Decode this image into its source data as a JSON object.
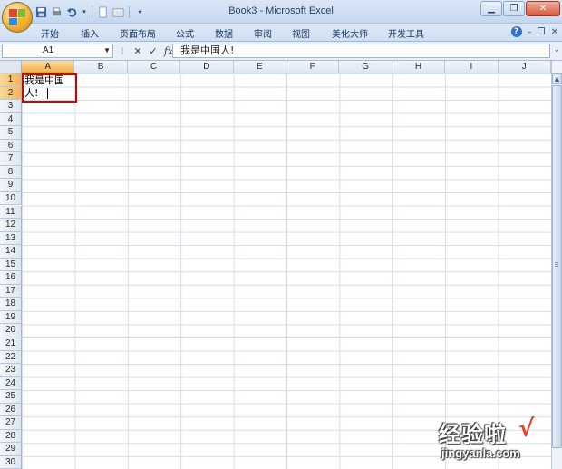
{
  "window": {
    "title": "Book3 - Microsoft Excel"
  },
  "tabs": [
    "开始",
    "插入",
    "页面布局",
    "公式",
    "数据",
    "审阅",
    "视图",
    "美化大师",
    "开发工具"
  ],
  "formula_bar": {
    "name_box": "A1",
    "content": "我是中国人!"
  },
  "columns": [
    "A",
    "B",
    "C",
    "D",
    "E",
    "F",
    "G",
    "H",
    "I",
    "J"
  ],
  "rows": [
    "1",
    "2",
    "3",
    "4",
    "5",
    "6",
    "7",
    "8",
    "9",
    "10",
    "11",
    "12",
    "13",
    "14",
    "15",
    "16",
    "17",
    "18",
    "19",
    "20",
    "21",
    "22",
    "23",
    "24",
    "25",
    "26",
    "27",
    "28",
    "29",
    "30"
  ],
  "cell_a1": {
    "line1": "我是中国",
    "line2": "人!"
  },
  "watermark": {
    "text": "经验啦",
    "check": "√",
    "url": "jingyanla.com"
  },
  "colors": {
    "selection_border": "#d40000",
    "selected_header": "#f2b457"
  }
}
